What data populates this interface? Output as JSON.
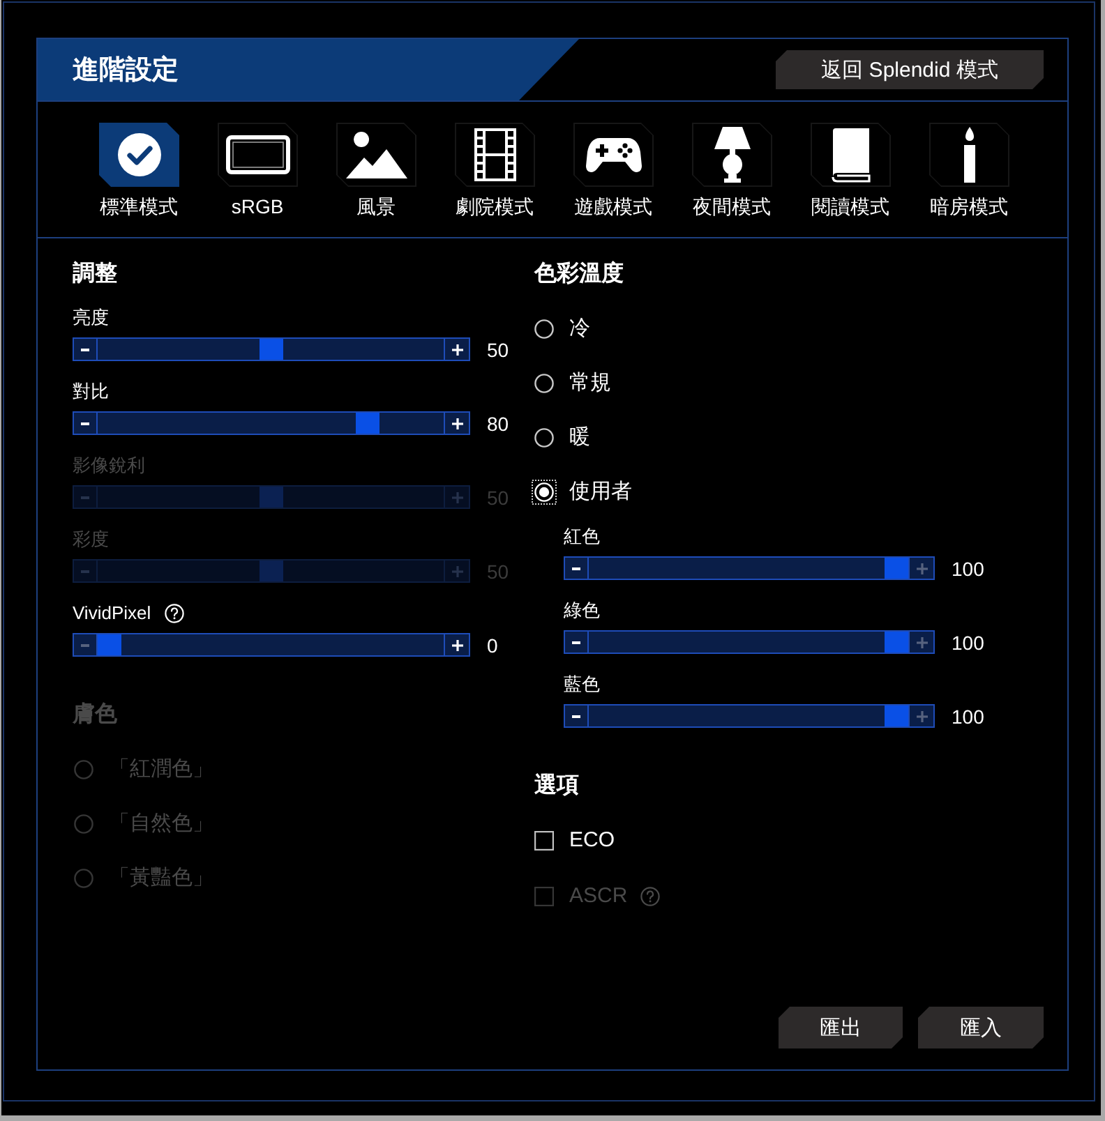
{
  "dialog": {
    "title": "進階設定",
    "back_button": "返回 Splendid 模式"
  },
  "modes": [
    {
      "label": "標準模式",
      "selected": true
    },
    {
      "label": "sRGB",
      "selected": false
    },
    {
      "label": "風景",
      "selected": false
    },
    {
      "label": "劇院模式",
      "selected": false
    },
    {
      "label": "遊戲模式",
      "selected": false
    },
    {
      "label": "夜間模式",
      "selected": false
    },
    {
      "label": "閱讀模式",
      "selected": false
    },
    {
      "label": "暗房模式",
      "selected": false
    }
  ],
  "adjust": {
    "title": "調整",
    "sliders": [
      {
        "label": "亮度",
        "level": 0.5,
        "reading": "50",
        "disabled": false,
        "help": false
      },
      {
        "label": "對比",
        "level": 0.8,
        "reading": "80",
        "disabled": false,
        "help": false
      },
      {
        "label": "影像銳利",
        "level": 0.5,
        "reading": "50",
        "disabled": true,
        "help": false
      },
      {
        "label": "彩度",
        "level": 0.5,
        "reading": "50",
        "disabled": true,
        "help": false
      },
      {
        "label": "VividPixel",
        "level": 0,
        "reading": "0",
        "disabled": false,
        "help": true
      }
    ]
  },
  "skin_tone": {
    "title": "膚色",
    "disabled": true,
    "options": [
      {
        "label": "「紅潤色」",
        "selected": false
      },
      {
        "label": "「自然色」",
        "selected": false
      },
      {
        "label": "「黃豔色」",
        "selected": false
      }
    ]
  },
  "color_temperature": {
    "title": "色彩溫度",
    "options": [
      {
        "label": "冷",
        "selected": false
      },
      {
        "label": "常規",
        "selected": false
      },
      {
        "label": "暖",
        "selected": false
      },
      {
        "label": "使用者",
        "selected": true
      }
    ],
    "user_sliders": [
      {
        "label": "紅色",
        "level": 1,
        "reading": "100"
      },
      {
        "label": "綠色",
        "level": 1,
        "reading": "100"
      },
      {
        "label": "藍色",
        "level": 1,
        "reading": "100"
      }
    ]
  },
  "options": {
    "title": "選項",
    "checkboxes": [
      {
        "label": "ECO",
        "checked": false,
        "disabled": false,
        "help": false
      },
      {
        "label": "ASCR",
        "checked": false,
        "disabled": true,
        "help": true
      }
    ]
  },
  "footer_buttons": [
    "匯出",
    "匯入"
  ]
}
